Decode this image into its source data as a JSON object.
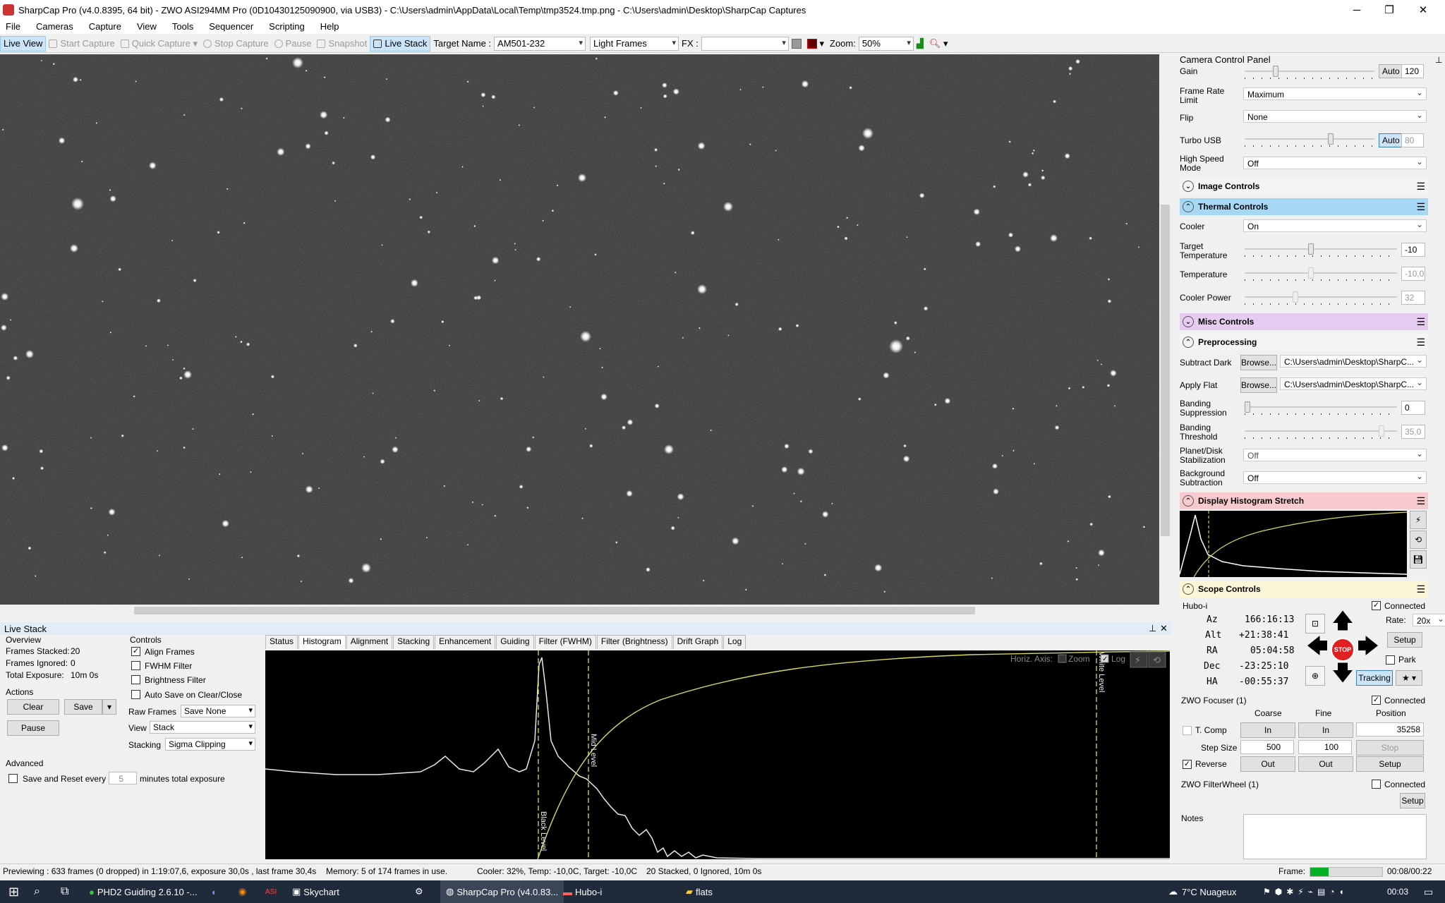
{
  "window": {
    "title": "SharpCap Pro (v4.0.8395, 64 bit) - ZWO ASI294MM Pro (0D10430125090900, via USB3) - C:\\Users\\admin\\AppData\\Local\\Temp\\tmp3524.tmp.png - C:\\Users\\admin\\Desktop\\SharpCap Captures",
    "minimize": "─",
    "restore": "❐",
    "close": "✕"
  },
  "menu": [
    "File",
    "Cameras",
    "Capture",
    "View",
    "Tools",
    "Sequencer",
    "Scripting",
    "Help"
  ],
  "toolbar": {
    "live_view": "Live View",
    "start_capture": "Start Capture",
    "quick_capture": "Quick Capture",
    "stop_capture": "Stop Capture",
    "pause": "Pause",
    "snapshot": "Snapshot",
    "live_stack": "Live Stack",
    "target_name_label": "Target Name :",
    "target_name_value": "AM501-232",
    "frame_type": "Light Frames",
    "fx_label": "FX :",
    "fx_value": "",
    "zoom_label": "Zoom:",
    "zoom_value": "50%"
  },
  "live_stack": {
    "header": "Live Stack",
    "pin": "⊥",
    "close": "✕",
    "overview_title": "Overview",
    "frames_stacked_label": "Frames Stacked:",
    "frames_stacked": "20",
    "frames_ignored_label": "Frames Ignored:",
    "frames_ignored": "0",
    "total_exposure_label": "Total Exposure:",
    "total_exposure": "10m 0s",
    "actions_title": "Actions",
    "clear": "Clear",
    "save": "Save",
    "pause": "Pause",
    "advanced_title": "Advanced",
    "save_reset_label": "Save and Reset every",
    "save_reset_value": "5",
    "save_reset_suffix": "minutes total exposure",
    "controls_title": "Controls",
    "align_frames": "Align Frames",
    "fwhm_filter": "FWHM Filter",
    "brightness_filter": "Brightness Filter",
    "auto_save": "Auto Save on Clear/Close",
    "raw_frames_label": "Raw Frames",
    "raw_frames_value": "Save None",
    "view_label": "View",
    "view_value": "Stack",
    "stacking_label": "Stacking",
    "stacking_value": "Sigma Clipping",
    "tabs": [
      "Status",
      "Histogram",
      "Alignment",
      "Stacking",
      "Enhancement",
      "Guiding",
      "Filter (FWHM)",
      "Filter (Brightness)",
      "Drift Graph",
      "Log"
    ],
    "active_tab": "Histogram",
    "histogram": {
      "horiz_axis_label": "Horiz. Axis:",
      "zoom_label": "Zoom",
      "log_label": "Log",
      "black_level": "Black Level",
      "mid_level": "Mid Level",
      "white_level": "White Level"
    }
  },
  "status_bar": {
    "previewing": "Previewing : 633 frames (0 dropped) in 1:19:07,6, exposure 30,0s , last frame 30,4s",
    "memory": "Memory: 5 of 174 frames in use.",
    "cooler": "Cooler: 32%, Temp: -10,0C, Target: -10,0C",
    "stacked": "20 Stacked, 0 Ignored, 10m 0s",
    "frame_label": "Frame:",
    "elapsed": "00:08/00:22"
  },
  "taskbar": {
    "items": [
      "PHD2 Guiding 2.6.10 -...",
      "Skychart",
      "SharpCap Pro (v4.0.83...",
      "Hubo-i",
      "flats"
    ],
    "weather": "7°C  Nuageux",
    "time": "00:03"
  },
  "camera_panel": {
    "title": "Camera Control Panel",
    "gain_label": "Gain",
    "gain_auto": "Auto",
    "gain_value": "120",
    "frame_rate_label": "Frame Rate Limit",
    "frame_rate_value": "Maximum",
    "flip_label": "Flip",
    "flip_value": "None",
    "turbo_usb_label": "Turbo USB",
    "turbo_auto": "Auto",
    "turbo_value": "80",
    "high_speed_label": "High Speed Mode",
    "high_speed_value": "Off",
    "image_controls": "Image Controls",
    "thermal_controls": "Thermal Controls",
    "cooler_label": "Cooler",
    "cooler_value": "On",
    "target_temp_label": "Target Temperature",
    "target_temp_value": "-10",
    "temperature_label": "Temperature",
    "temperature_value": "-10,0",
    "cooler_power_label": "Cooler Power",
    "cooler_power_value": "32",
    "misc_controls": "Misc Controls",
    "preprocessing": "Preprocessing",
    "subtract_dark_label": "Subtract Dark",
    "browse": "Browse...",
    "subtract_dark_value": "C:\\Users\\admin\\Desktop\\SharpC...",
    "apply_flat_label": "Apply Flat",
    "apply_flat_value": "C:\\Users\\admin\\Desktop\\SharpC...",
    "banding_supp_label": "Banding Suppression",
    "banding_supp_value": "0",
    "banding_thresh_label": "Banding Threshold",
    "banding_thresh_value": "35,0",
    "planet_stab_label": "Planet/Disk Stabilization",
    "planet_stab_value": "Off",
    "bg_sub_label": "Background Subtraction",
    "bg_sub_value": "Off",
    "display_histo": "Display Histogram Stretch",
    "scope_controls": "Scope Controls",
    "mount_name": "Hubo-i",
    "connected": "Connected",
    "az_label": "Az",
    "az_value": "166:16:13",
    "alt_label": "Alt",
    "alt_value": "+21:38:41",
    "ra_label": "RA",
    "ra_value": "05:04:58",
    "dec_label": "Dec",
    "dec_value": "-23:25:10",
    "ha_label": "HA",
    "ha_value": "-00:55:37",
    "rate_label": "Rate:",
    "rate_value": "20x",
    "setup": "Setup",
    "park": "Park",
    "stop": "STOP",
    "tracking": "Tracking",
    "focuser_name": "ZWO Focuser (1)",
    "coarse": "Coarse",
    "fine": "Fine",
    "position": "Position",
    "t_comp": "T. Comp",
    "in": "In",
    "out": "Out",
    "position_value": "35258",
    "step_size_label": "Step Size",
    "step_coarse": "500",
    "step_fine": "100",
    "stop_btn": "Stop",
    "reverse": "Reverse",
    "filterwheel_name": "ZWO FilterWheel (1)",
    "notes_label": "Notes"
  },
  "colors": {
    "thermal_header": "#a6d8f5",
    "misc_header": "#e6ccf0",
    "display_histo_header": "#f9c9d0",
    "scope_header": "#fdf6d6",
    "stop_red": "#e02020",
    "curve_yellow": "#d8d860"
  }
}
